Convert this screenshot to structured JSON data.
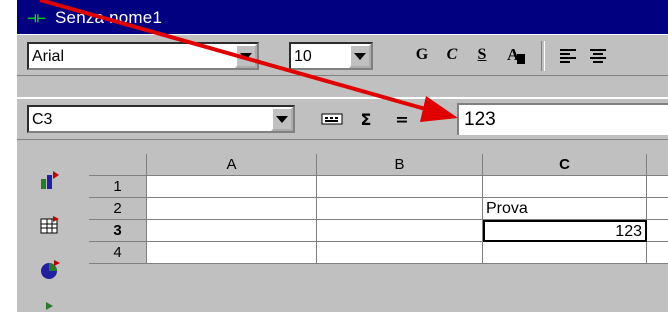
{
  "window": {
    "title": "Senza nome1"
  },
  "toolbar1": {
    "font_name": "Arial",
    "font_size": "10",
    "bold_label": "G",
    "italic_label": "C",
    "underline_label": "S"
  },
  "toolbar2": {
    "cell_ref": "C3",
    "sum_label": "Σ",
    "equals_label": "=",
    "formula_value": "123"
  },
  "grid": {
    "columns": [
      "A",
      "B",
      "C"
    ],
    "rows": [
      "1",
      "2",
      "3",
      "4"
    ],
    "cells": {
      "C2": "Prova",
      "C3": "123"
    }
  },
  "colors": {
    "title_bg": "#000080",
    "face": "#c0c0c0",
    "arrow": "#e00000"
  }
}
